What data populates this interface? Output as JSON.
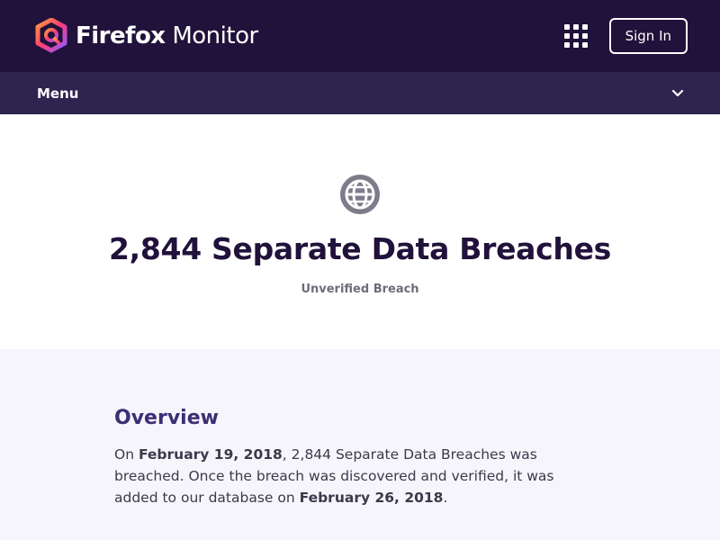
{
  "header": {
    "brand_bold": "Firefox",
    "brand_light": "Monitor",
    "apps_icon": "apps-grid-icon",
    "signin_label": "Sign In"
  },
  "menubar": {
    "label": "Menu",
    "icon": "chevron-down-icon"
  },
  "breach": {
    "icon": "globe-icon",
    "title": "2,844 Separate Data Breaches",
    "badge": "Unverified Breach"
  },
  "overview": {
    "heading": "Overview",
    "text_1": "On ",
    "breach_date": "February 19, 2018",
    "text_2": ", 2,844 Separate Data Breaches was breached. Once the breach was discovered and verified, it was added to our database on ",
    "added_date": "February 26, 2018",
    "text_3": "."
  },
  "colors": {
    "header_bg": "#20123a",
    "menubar_bg": "#2f2450",
    "overview_bg": "#f7f5fc",
    "accent": "#3d2f74"
  }
}
